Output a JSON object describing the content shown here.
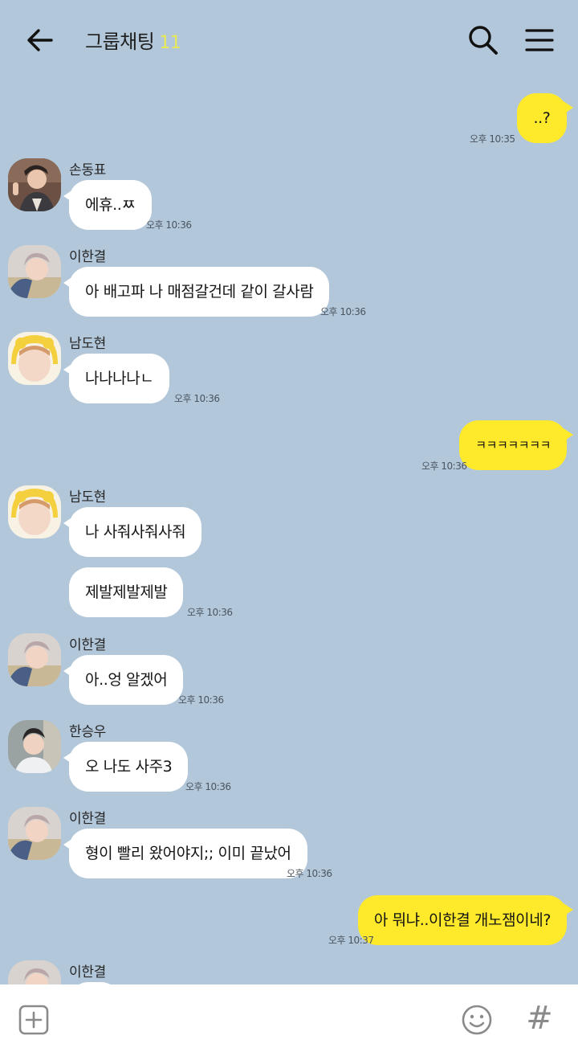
{
  "header": {
    "title": "그룹채팅",
    "member_count": "11",
    "back_icon": "arrow-left-icon",
    "search_icon": "search-icon",
    "menu_icon": "hamburger-menu-icon"
  },
  "colors": {
    "background": "#b2c7da",
    "outgoing_bubble": "#fee92b",
    "incoming_bubble": "#ffffff",
    "member_count": "#e8ea55"
  },
  "messages": [
    {
      "direction": "out",
      "text": "..?",
      "time": "오후 10:35"
    },
    {
      "direction": "in",
      "sender": "손동표",
      "text": "에휴..ㅉ",
      "time": "오후 10:36"
    },
    {
      "direction": "in",
      "sender": "이한결",
      "text": "아 배고파 나 매점갈건데 같이 갈사람",
      "time": "오후 10:36"
    },
    {
      "direction": "in",
      "sender": "남도현",
      "text": "나나나나ㄴ",
      "time": "오후 10:36"
    },
    {
      "direction": "out",
      "text": "ㅋㅋㅋㅋㅋㅋㅋ",
      "time": "오후 10:36"
    },
    {
      "direction": "in",
      "sender": "남도현",
      "text": "나 사줘사줘사줘"
    },
    {
      "direction": "in",
      "text": "제발제발제발",
      "time": "오후 10:36"
    },
    {
      "direction": "in",
      "sender": "이한결",
      "text": "아..엉 알겠어",
      "time": "오후 10:36"
    },
    {
      "direction": "in",
      "sender": "한승우",
      "text": "오 나도 사주3",
      "time": "오후 10:36"
    },
    {
      "direction": "in",
      "sender": "이한결",
      "text": "형이 빨리 왔어야지;; 이미 끝났어",
      "time": "오후 10:36"
    },
    {
      "direction": "out",
      "text": "아 뭐냐..이한결 개노잼이네?",
      "time": "오후 10:37"
    },
    {
      "direction": "in",
      "sender": "이한결"
    }
  ],
  "input_bar": {
    "plus_icon": "plus-square-icon",
    "emoji_icon": "smiley-icon",
    "hash_label": "#"
  }
}
